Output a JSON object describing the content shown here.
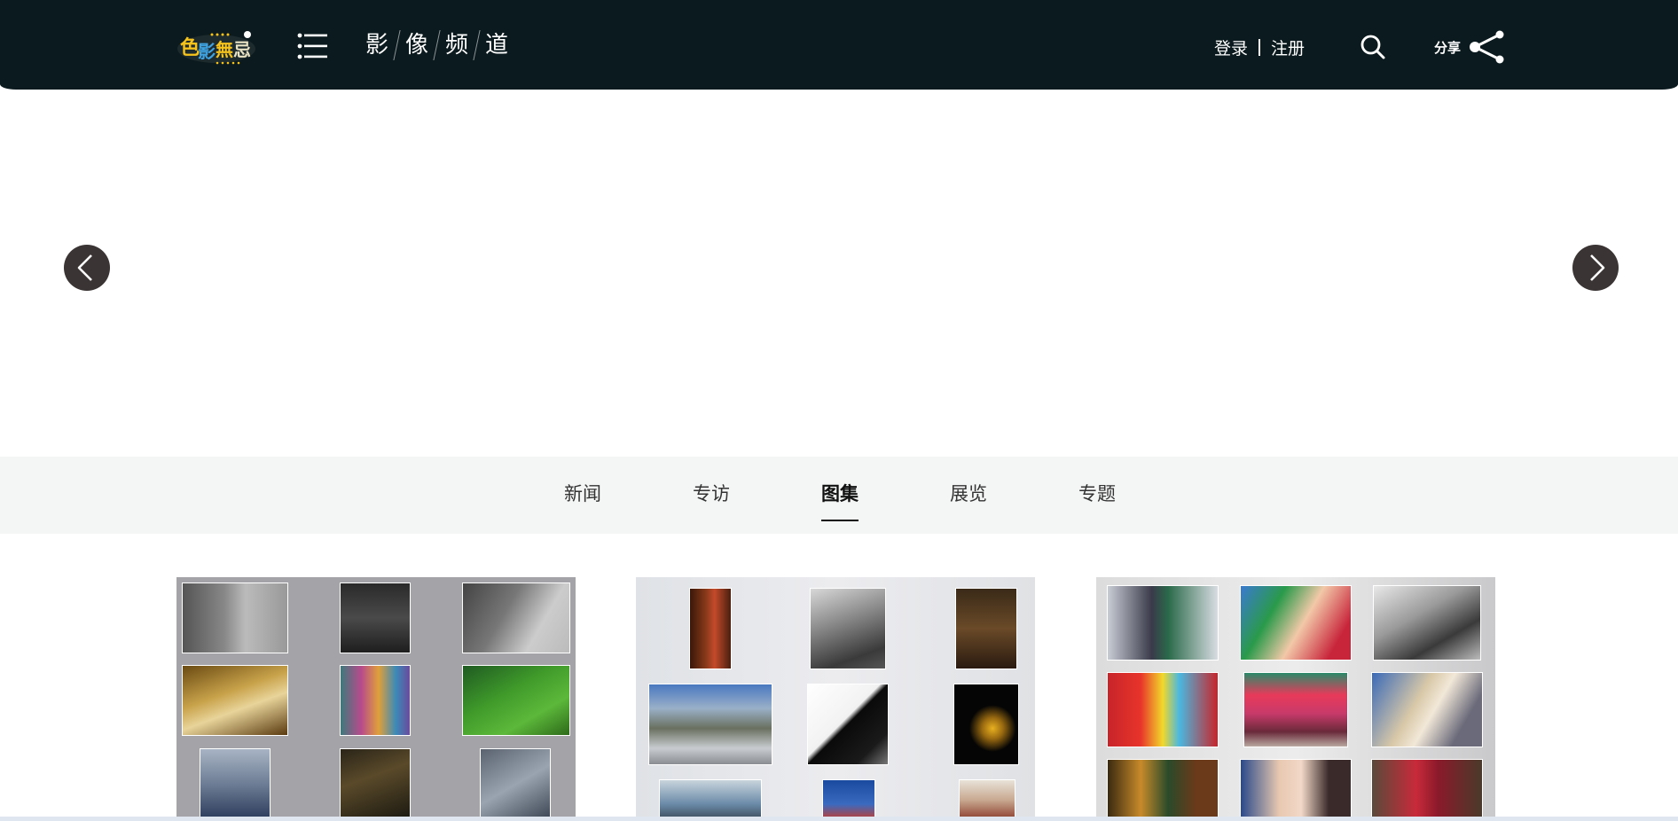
{
  "header": {
    "logo_alt": "色影无忌",
    "channel_chars": [
      "影",
      "像",
      "频",
      "道"
    ],
    "login_label": "登录",
    "register_label": "注册",
    "share_label": "分享",
    "icons": [
      "menu-icon",
      "search-icon",
      "share-icon"
    ]
  },
  "banner": {
    "prev_icon": "chevron-left-icon",
    "next_icon": "chevron-right-icon"
  },
  "tabs": [
    {
      "label": "新闻",
      "active": false
    },
    {
      "label": "专访",
      "active": false
    },
    {
      "label": "图集",
      "active": true
    },
    {
      "label": "展览",
      "active": false
    },
    {
      "label": "专题",
      "active": false
    }
  ],
  "colors": {
    "header_bg": "#0b1a1e",
    "tab_bar_bg": "#f4f6f5",
    "arrow_bg": "#3a3434",
    "text_white": "#ffffff"
  },
  "gallery": {
    "cards": [
      {
        "name": "album-card-1",
        "theme": "grey-street-photos"
      },
      {
        "name": "album-card-2",
        "theme": "documentary-photos"
      },
      {
        "name": "album-card-3",
        "theme": "portrait-photos"
      }
    ]
  }
}
